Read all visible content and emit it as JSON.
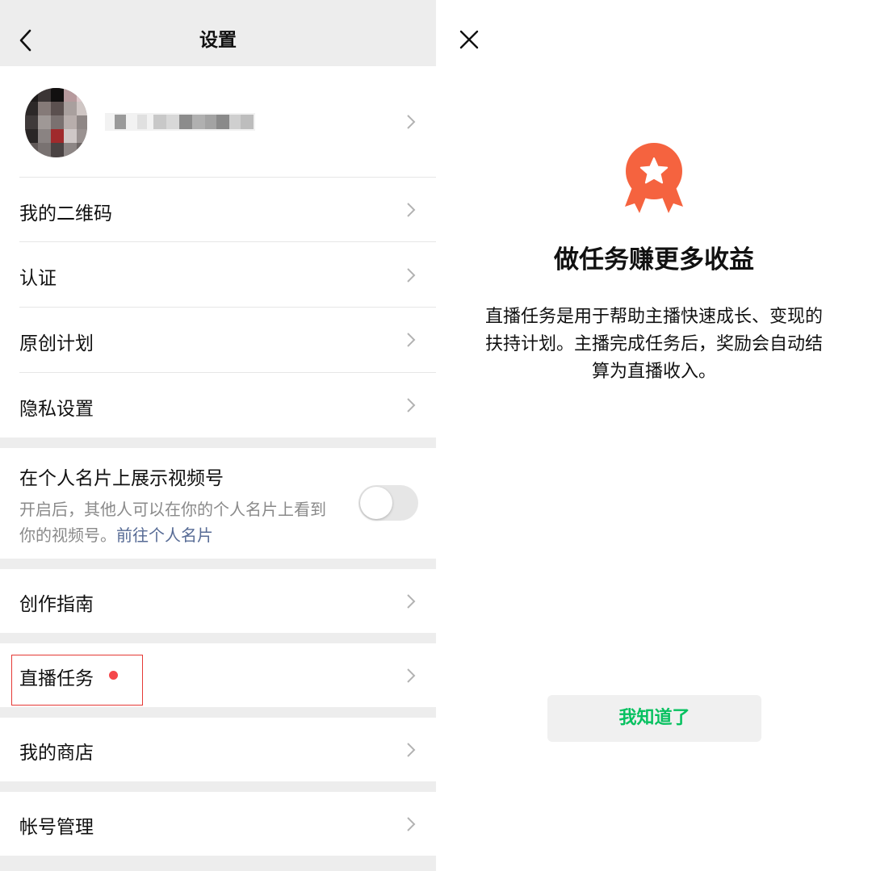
{
  "settings": {
    "title": "设置",
    "menu": {
      "qr_code": "我的二维码",
      "verification": "认证",
      "original_plan": "原创计划",
      "privacy": "隐私设置"
    },
    "card_display": {
      "title": "在个人名片上展示视频号",
      "description": "开启后，其他人可以在你的个人名片上看到你的视频号。",
      "link": "前往个人名片",
      "enabled": false
    },
    "creation_guide": "创作指南",
    "live_tasks": "直播任务",
    "my_shop": "我的商店",
    "account_management": "帐号管理"
  },
  "task_popup": {
    "title": "做任务赚更多收益",
    "description": "直播任务是用于帮助主播快速成长、变现的扶持计划。主播完成任务后，奖励会自动结算为直播收入。",
    "confirm_button": "我知道了"
  },
  "colors": {
    "accent_green": "#07c160",
    "badge_orange": "#f5633f",
    "link_blue": "#576b95",
    "dot_red": "#f5474b"
  }
}
